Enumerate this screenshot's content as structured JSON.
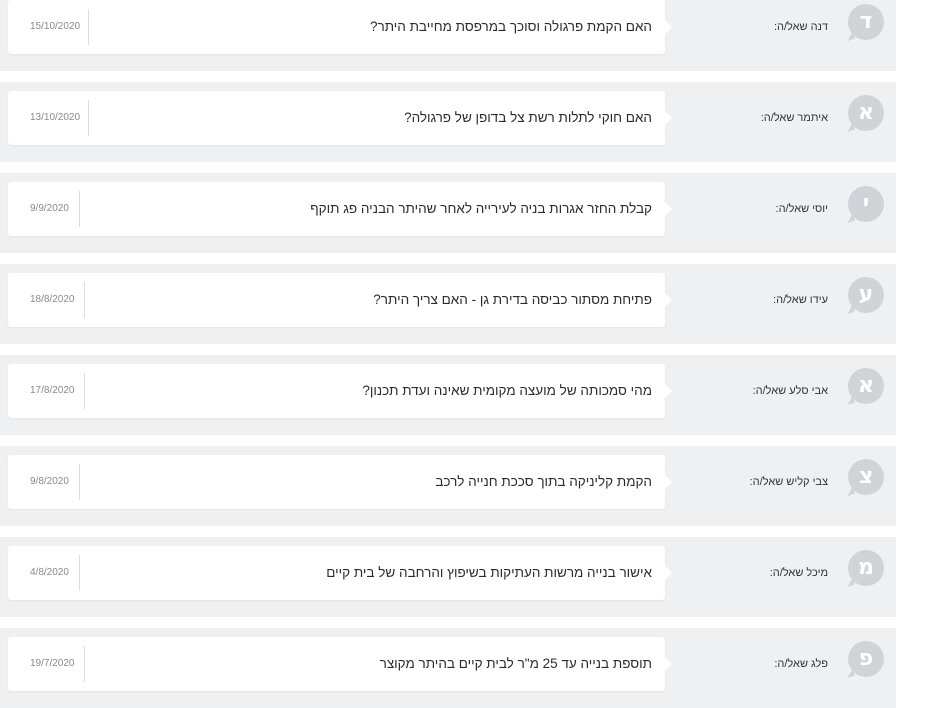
{
  "questions": [
    {
      "asker": "דנה שאל/ה:",
      "initial": "ד",
      "text": "האם הקמת פרגולה וסוכך במרפסת מחייבת היתר?",
      "date": "15/10/2020"
    },
    {
      "asker": "איתמר שאל/ה:",
      "initial": "א",
      "text": "האם חוקי לתלות רשת צל בדופן של פרגולה?",
      "date": "13/10/2020"
    },
    {
      "asker": "יוסי שאל/ה:",
      "initial": "י",
      "text": "קבלת החזר אגרות בניה לעירייה לאחר שהיתר הבניה פג תוקף",
      "date": "9/9/2020"
    },
    {
      "asker": "עידו שאל/ה:",
      "initial": "ע",
      "text": "פתיחת מסתור כביסה בדירת גן - האם צריך היתר?",
      "date": "18/8/2020"
    },
    {
      "asker": "אבי סלע שאל/ה:",
      "initial": "א",
      "text": "מהי סמכותה של מועצה מקומית שאינה ועדת תכנון?",
      "date": "17/8/2020"
    },
    {
      "asker": "צבי קליש שאל/ה:",
      "initial": "צ",
      "text": "הקמת קליניקה בתוך סככת חנייה לרכב",
      "date": "9/8/2020"
    },
    {
      "asker": "מיכל שאל/ה:",
      "initial": "מ",
      "text": "אישור בנייה מרשות העתיקות בשיפוץ והרחבה של בית קיים",
      "date": "4/8/2020"
    },
    {
      "asker": "פלג שאל/ה:",
      "initial": "פ",
      "text": "תוספת בנייה עד 25 מ\"ר לבית קיים בהיתר מקוצר",
      "date": "19/7/2020"
    }
  ]
}
